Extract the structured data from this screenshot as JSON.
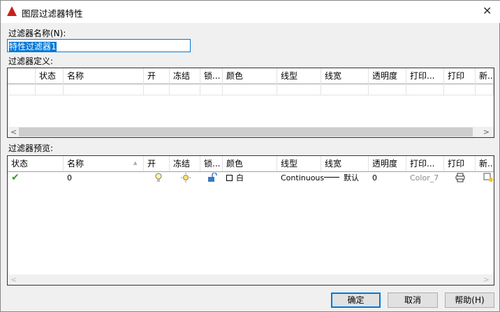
{
  "window": {
    "title": "图层过滤器特性",
    "close": "✕"
  },
  "filter_name": {
    "label": "过滤器名称(N):",
    "value": "特性过滤器1"
  },
  "definition": {
    "label": "过滤器定义:",
    "columns": [
      "",
      "状态",
      "名称",
      "开",
      "冻结",
      "锁...",
      "颜色",
      "线型",
      "线宽",
      "透明度",
      "打印...",
      "打印",
      "新..."
    ]
  },
  "preview": {
    "label": "过滤器预览:",
    "columns": [
      "状态",
      "名称",
      "开",
      "冻结",
      "锁...",
      "颜色",
      "线型",
      "线宽",
      "透明度",
      "打印...",
      "打印",
      "新..."
    ],
    "rows": [
      {
        "status": "✔",
        "name": "0",
        "on": "bulb-icon",
        "freeze": "sun-icon",
        "lock": "unlock-icon",
        "color": "白",
        "linetype": "Continuous",
        "lineweight": "默认",
        "transparency": "0",
        "plot_style": "Color_7",
        "plot": "printer-icon",
        "new_vp": "new-vp-freeze-icon"
      }
    ]
  },
  "buttons": {
    "ok": "确定",
    "cancel": "取消",
    "help": "帮助(H)"
  }
}
